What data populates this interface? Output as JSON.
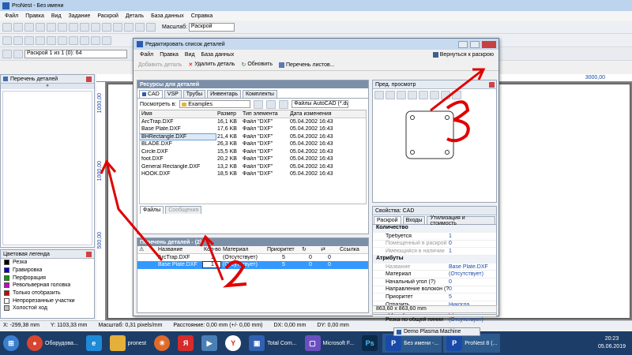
{
  "app": {
    "title": "ProNest - Без имени"
  },
  "menu": [
    "Файл",
    "Правка",
    "Вид",
    "Задание",
    "Раскрой",
    "Деталь",
    "База данных",
    "Справка"
  ],
  "toolbar": {
    "scale_label": "Масштаб:",
    "scale_value": "Раскрой",
    "plan_value": "Раскрой 1 из 1 (0): 64"
  },
  "left_panel": {
    "title": "Перечень деталей"
  },
  "ruler": {
    "top_value": "3000,00",
    "left_top": "1000,00",
    "left_mid": "1000,00",
    "left_bottom": "500,00"
  },
  "legend": {
    "title": "Цветовая легенда",
    "items": [
      {
        "label": "Резка",
        "color": "#000000"
      },
      {
        "label": "Гравировка",
        "color": "#0000cc"
      },
      {
        "label": "Перфорация",
        "color": "#00a000"
      },
      {
        "label": "Револьверная головка",
        "color": "#cc00cc"
      },
      {
        "label": "Только отобразить",
        "color": "#cc0000"
      },
      {
        "label": "Непрорезанные участки",
        "color": "#ffffff"
      },
      {
        "label": "Холостой ход",
        "color": "#c0c0c0"
      }
    ]
  },
  "status": {
    "x": "X: -299,38 mm",
    "y": "Y: 1103,33 mm",
    "scale": "Масштаб: 0,31 pixels/mm",
    "distance": "Расстояние: 0,00 mm (+/- 0,00 mm)",
    "dx": "DX: 0,00 mm",
    "dy": "DY: 0,00 mm"
  },
  "dialog": {
    "title": "Редактировать список деталей",
    "menu": [
      "Файл",
      "Правка",
      "Вид",
      "База данных"
    ],
    "return_label": "Вернуться к раскрою",
    "actions": {
      "add": "Добавить деталь",
      "remove": "Удалить деталь",
      "refresh": "Обновить",
      "sheets": "Перечень листов..."
    },
    "resources": {
      "title": "Ресурсы для деталей",
      "tabs": [
        "CAD",
        "VSP",
        "Трубы",
        "Инвентарь",
        "Комплекты"
      ],
      "view_label": "Посмотреть в:",
      "folder": "Examples",
      "filter": "Файлы AutoCAD (*.dwg;*.d"
    },
    "files": {
      "headers": [
        "Имя",
        "Размер",
        "Тип элемента",
        "Дата изменения"
      ],
      "rows": [
        [
          "ArcTrap.DXF",
          "16,1 KB",
          "Файл \"DXF\"",
          "05.04.2002 16:43"
        ],
        [
          "Base Plate.DXF",
          "17,6 KB",
          "Файл \"DXF\"",
          "05.04.2002 16:43"
        ],
        [
          "BHRectangle.DXF",
          "21,4 KB",
          "Файл \"DXF\"",
          "05.04.2002 16:43"
        ],
        [
          "BLADE.DXF",
          "26,3 KB",
          "Файл \"DXF\"",
          "05.04.2002 16:43"
        ],
        [
          "Circle.DXF",
          "15,5 KB",
          "Файл \"DXF\"",
          "05.04.2002 16:43"
        ],
        [
          "foot.DXF",
          "20,2 KB",
          "Файл \"DXF\"",
          "05.04.2002 16:43"
        ],
        [
          "General Rectangle.DXF",
          "13,2 KB",
          "Файл \"DXF\"",
          "05.04.2002 16:43"
        ],
        [
          "HOOK.DXF",
          "18,5 KB",
          "Файл \"DXF\"",
          "05.04.2002 16:43"
        ]
      ],
      "bottom_tabs": [
        "Файлы",
        "Сообщения"
      ]
    },
    "parts": {
      "title": "Перечень деталей - (2)",
      "headers": [
        "Название",
        "Кол-во",
        "Материал",
        "Приоритет",
        "",
        "",
        "Ссылка"
      ],
      "rows": [
        [
          "ArcTrap.DXF",
          "1",
          "(Отсутствует)",
          "5",
          "0",
          "0",
          ""
        ],
        [
          "Base Plate.DXF",
          "1",
          "(Отсутствует)",
          "5",
          "0",
          "0",
          ""
        ]
      ]
    },
    "preview": {
      "title": "Пред. просмотр"
    },
    "props": {
      "title": "Свойства: CAD",
      "tabs": [
        "Раскрой",
        "Входы",
        "Утилизация и стоимость"
      ],
      "sections": [
        {
          "title": "Количество",
          "rows": [
            [
              "Требуется",
              "1"
            ],
            [
              "Помещенный в раскрой",
              "0"
            ],
            [
              "Имеющийся в наличии",
              "1"
            ]
          ]
        },
        {
          "title": "Атрибуты",
          "rows": [
            [
              "Название",
              "Base Plate.DXF"
            ],
            [
              "Материал",
              "(Отсутствует)"
            ],
            [
              "Начальный угол (?)",
              "0"
            ],
            [
              "Направление волокон (?)",
              "0"
            ],
            [
              "Приоритет",
              "5"
            ],
            [
              "Отразить",
              "Никогда"
            ],
            [
              "Группировка",
              ""
            ],
            [
              "Резка по общей линии",
              "(Отсутствует)"
            ]
          ]
        }
      ],
      "size": "863,60 x 863,60 mm"
    }
  },
  "taskbar": {
    "items": [
      "Оборудова...",
      "pronest",
      "",
      "Я",
      "",
      "Y",
      "Total Com...",
      "Microsoft F...",
      "",
      "Без имени -...",
      "ProNest 8 (..."
    ],
    "tray_window": "Demo Plasma Machine",
    "time": "20:23",
    "date": "05.06.2019"
  }
}
